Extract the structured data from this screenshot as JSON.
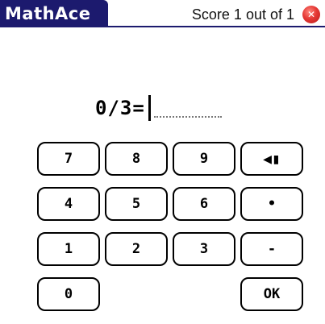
{
  "app": {
    "name": "MathAce",
    "score_text": "Score 1 out of 1"
  },
  "icons": {
    "close": "close-icon",
    "backspace": "backspace-icon"
  },
  "equation": {
    "text": "0/3=",
    "answer_value": ""
  },
  "keypad": {
    "row1": [
      "7",
      "8",
      "9",
      "◀▮"
    ],
    "row2": [
      "4",
      "5",
      "6",
      "•"
    ],
    "row3": [
      "1",
      "2",
      "3",
      "-"
    ],
    "row4": [
      "0",
      "OK"
    ]
  },
  "colors": {
    "title_bar": "#1c1a6e",
    "close_button": "#e53935"
  }
}
